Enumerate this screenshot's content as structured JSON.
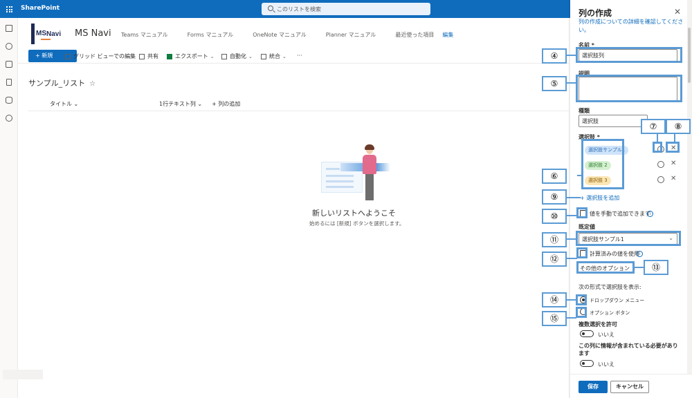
{
  "suitebar": {
    "app_name": "SharePoint",
    "search_placeholder": "このリストを検索"
  },
  "site": {
    "logo_ms": "MS",
    "logo_navi": "Navi",
    "title": "MS Navi",
    "nav": [
      "Teams マニュアル",
      "Forms マニュアル",
      "OneNote マニュアル",
      "Planner マニュアル",
      "最近使った項目"
    ],
    "edit_label": "編集"
  },
  "command_bar": {
    "new_label": "+ 新規",
    "grid_edit": "グリッド ビューでの編集",
    "share": "共有",
    "export": "エクスポート",
    "automate": "自動化",
    "integrate": "統合",
    "more": "···"
  },
  "list": {
    "title": "サンプル_リスト",
    "columns": [
      "タイトル",
      "1行テキスト列",
      "+ 列の追加"
    ],
    "empty_title": "新しいリストへようこそ",
    "empty_subtitle": "始めるには [新規] ボタンを選択します。"
  },
  "panel": {
    "title": "列の作成",
    "learn_more": "列の作成についての詳細を確認してください。",
    "name_label": "名前 *",
    "name_value": "選択肢列",
    "description_label": "説明",
    "type_label": "種類",
    "type_value": "選択肢",
    "choices_label": "選択肢 *",
    "choices": [
      "選択肢サンプル1",
      "選択肢 2",
      "選択肢 3"
    ],
    "add_choice": "+ 選択肢を追加",
    "allow_manual": "値を手動で追加できます",
    "default_label": "既定値",
    "default_value": "選択肢サンプル1",
    "use_calculated": "計算済みの値を使用",
    "more_options": "その他のオプション",
    "display_label": "次の形式で選択肢を表示:",
    "radio_dropdown": "ドロップダウン メニュー",
    "radio_option": "オプション ボタン",
    "multi_label": "複数選択を許可",
    "multi_value": "いいえ",
    "required_label": "この列に情報が含まれている必要があります",
    "required_value": "いいえ",
    "save": "保存",
    "cancel": "キャンセル"
  },
  "callouts": {
    "c4": "④",
    "c5": "⑤",
    "c6": "⑥",
    "c7": "⑦",
    "c8": "⑧",
    "c9": "⑨",
    "c10": "⑩",
    "c11": "⑪",
    "c12": "⑫",
    "c13": "⑬",
    "c14": "⑭",
    "c15": "⑮"
  },
  "colors": {
    "accent": "#0f6cbd",
    "annotation": "#5b9bd5"
  }
}
